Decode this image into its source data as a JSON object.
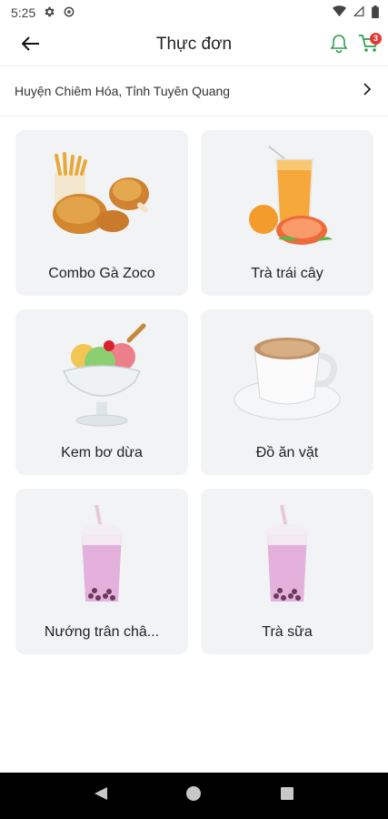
{
  "status_bar": {
    "time": "5:25",
    "icons": [
      "settings-icon",
      "sync-icon",
      "wifi-icon",
      "signal-icon",
      "battery-icon"
    ]
  },
  "app_bar": {
    "title": "Thực đơn",
    "back_icon": "arrow-back-icon",
    "bell_icon": "bell-icon",
    "cart_icon": "cart-icon",
    "cart_count": "3",
    "accent_color": "#2e9e4f",
    "badge_color": "#e53935"
  },
  "location": {
    "text": "Huyện Chiêm Hóa, Tỉnh Tuyên Quang",
    "chevron_icon": "chevron-right-icon"
  },
  "menu_items": [
    {
      "label": "Combo Gà Zoco",
      "icon": "fried-chicken-icon"
    },
    {
      "label": "Trà trái cây",
      "icon": "fruit-tea-icon"
    },
    {
      "label": "Kem bơ dừa",
      "icon": "ice-cream-icon"
    },
    {
      "label": "Đồ ăn vặt",
      "icon": "coffee-cup-icon"
    },
    {
      "label": "Nướng trân châ...",
      "icon": "bubble-tea-icon"
    },
    {
      "label": "Trà sữa",
      "icon": "bubble-tea-icon"
    }
  ],
  "nav_bar": {
    "back": "nav-back-icon",
    "home": "nav-home-icon",
    "recents": "nav-recents-icon"
  }
}
